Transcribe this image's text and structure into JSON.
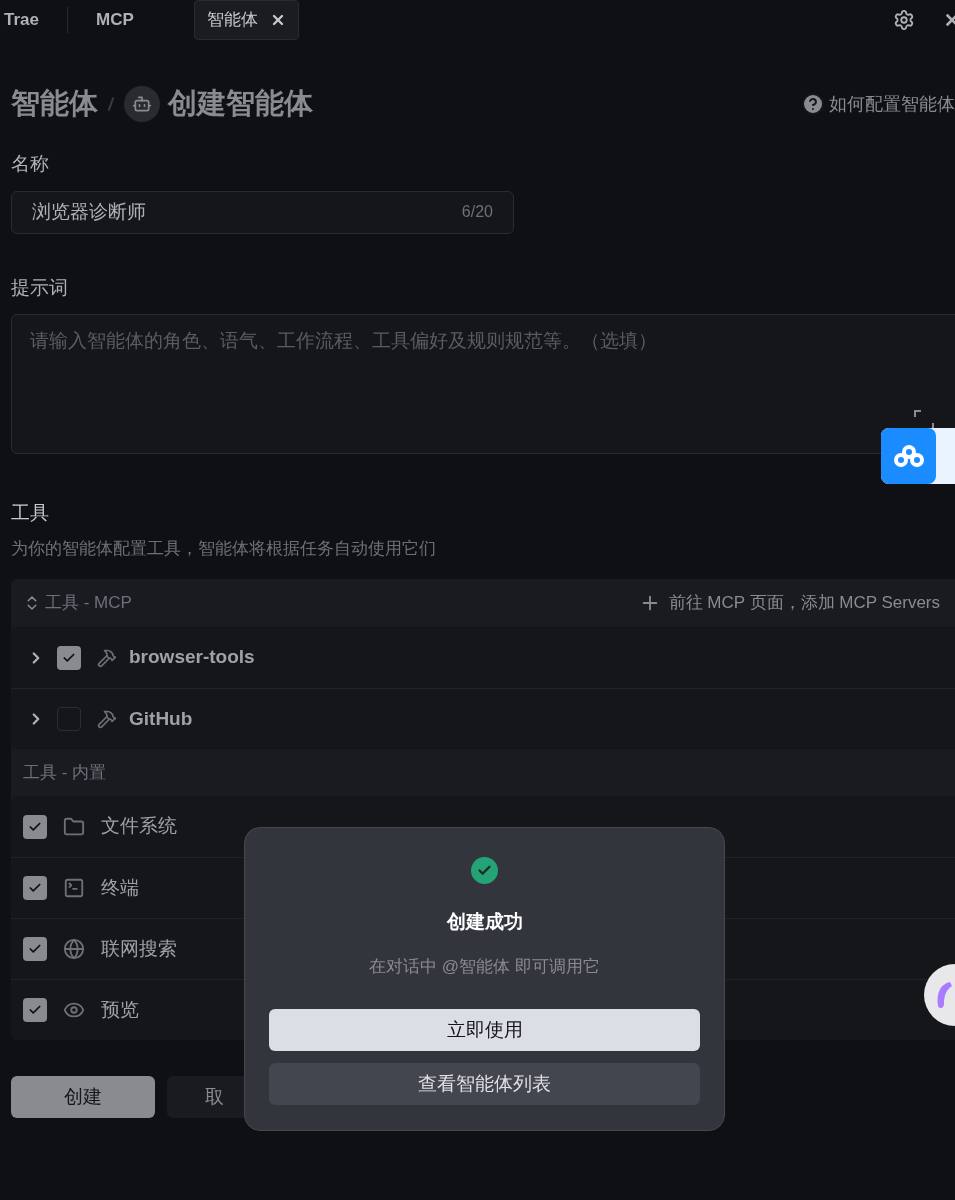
{
  "tabs": [
    {
      "label": "Trae",
      "selected": false,
      "kind": "brand"
    },
    {
      "label": "MCP",
      "selected": false,
      "kind": "tab"
    },
    {
      "label": "智能体",
      "selected": true,
      "kind": "tab"
    }
  ],
  "breadcrumb": {
    "parent": "智能体",
    "current": "创建智能体"
  },
  "help_link": "如何配置智能体",
  "name_field": {
    "label": "名称",
    "value": "浏览器诊断师",
    "counter": "6/20"
  },
  "prompt_field": {
    "label": "提示词",
    "placeholder": "请输入智能体的角色、语气、工作流程、工具偏好及规则规范等。（选填）"
  },
  "tools": {
    "title": "工具",
    "description": "为你的智能体配置工具，智能体将根据任务自动使用它们",
    "mcp_header": "工具 - MCP",
    "add_link": "前往 MCP 页面，添加 MCP Servers",
    "mcp_tools": [
      {
        "name": "browser-tools",
        "checked": true
      },
      {
        "name": "GitHub",
        "checked": false
      }
    ],
    "builtin_header": "工具 - 内置",
    "builtin_tools": [
      {
        "name": "文件系统",
        "kind": "folder",
        "checked": true
      },
      {
        "name": "终端",
        "kind": "terminal",
        "checked": true
      },
      {
        "name": "联网搜索",
        "kind": "globe",
        "checked": true
      },
      {
        "name": "预览",
        "kind": "eye",
        "checked": true
      }
    ]
  },
  "actions": [
    {
      "label": "创建",
      "kind": "primary"
    },
    {
      "label": "取",
      "kind": "secondary"
    }
  ],
  "dialog": {
    "title": "创建成功",
    "message": "在对话中 @智能体 即可调用它",
    "buttons": [
      {
        "label": "立即使用",
        "kind": "primary"
      },
      {
        "label": "查看智能体列表",
        "kind": "secondary"
      }
    ]
  }
}
